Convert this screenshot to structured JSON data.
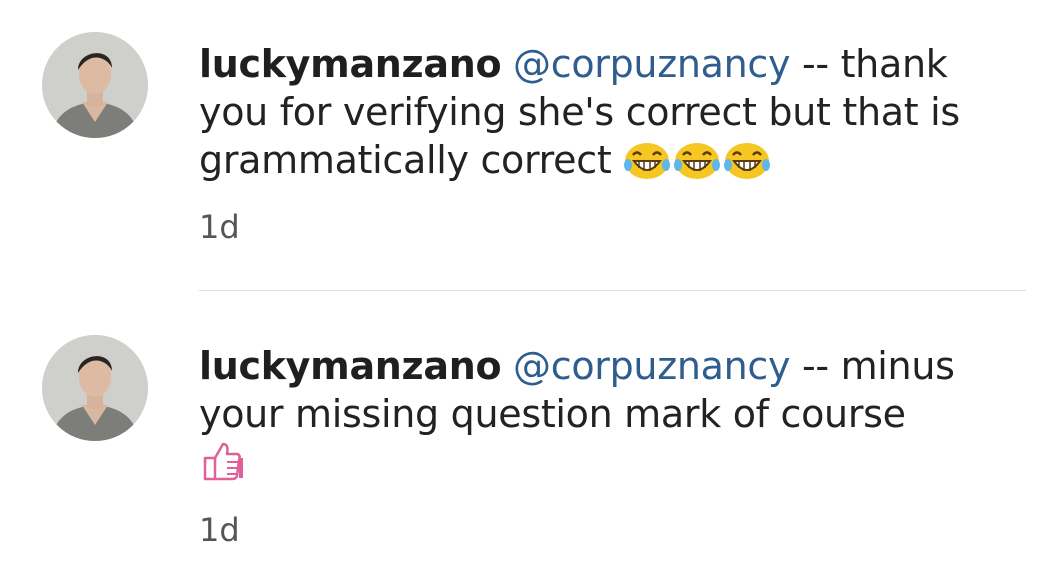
{
  "comments": [
    {
      "username": "luckymanzano",
      "mention": "@corpuznancy",
      "text": " -- thank you for verifying she's correct but that is grammatically correct ",
      "emojis": [
        "tears-of-joy-emoji",
        "tears-of-joy-emoji",
        "tears-of-joy-emoji"
      ],
      "time": "1d"
    },
    {
      "username": "luckymanzano",
      "mention": "@corpuznancy",
      "text": " -- minus your missing question mark of course",
      "emojis": [
        "thumbs-up-emoji"
      ],
      "time": "1d"
    }
  ],
  "colors": {
    "mention": "#2f5d8e",
    "username": "#1f1f1f",
    "timestamp": "#555555",
    "thumbs_up": "#e0609a",
    "emoji_face": "#f6c623"
  }
}
